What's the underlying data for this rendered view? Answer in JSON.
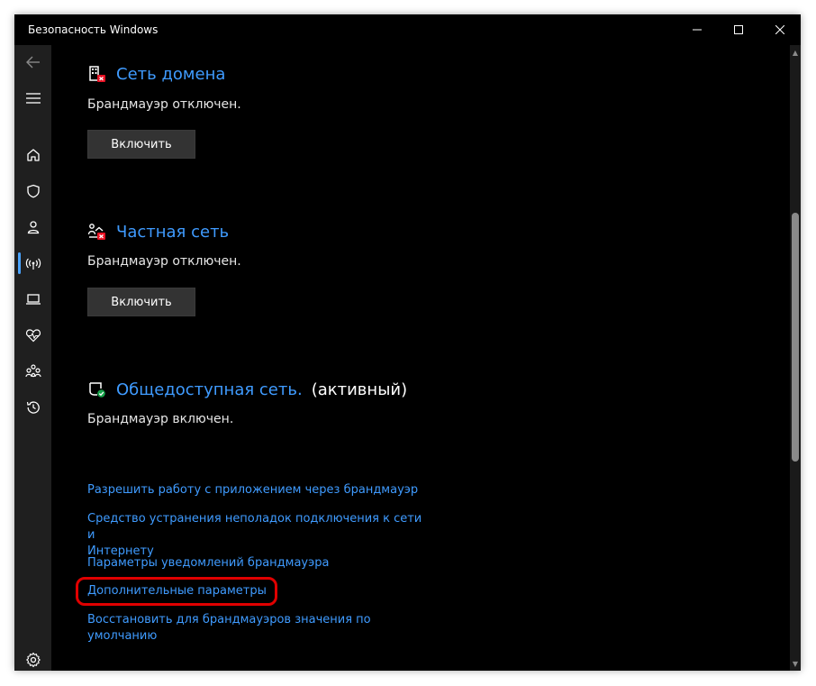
{
  "window": {
    "title": "Безопасность Windows"
  },
  "sections": [
    {
      "title": "Сеть домена",
      "suffix": "",
      "status": "Брандмауэр отключен.",
      "button_label": "Включить",
      "icon": "domain-network-icon"
    },
    {
      "title": "Частная сеть",
      "suffix": "",
      "status": "Брандмауэр отключен.",
      "button_label": "Включить",
      "icon": "private-network-icon"
    },
    {
      "title": "Общедоступная сеть.",
      "suffix": "(активный)",
      "status": "Брандмауэр включен.",
      "icon": "public-network-icon"
    }
  ],
  "links": {
    "allow_app": "Разрешить работу с приложением через брандмауэр",
    "troubleshooter_line1": "Средство устранения неполадок подключения к сети и",
    "troubleshooter_line2": "Интернету",
    "notifications": "Параметры уведомлений брандмауэра",
    "advanced": "Дополнительные параметры",
    "restore_defaults": "Восстановить для брандмауэров значения по умолчанию"
  },
  "sidebar": {
    "items": [
      "back-arrow-icon",
      "hamburger-menu-icon",
      "home-icon",
      "shield-icon",
      "account-icon",
      "network-antenna-icon",
      "device-laptop-icon",
      "health-heart-icon",
      "family-icon",
      "history-icon",
      "settings-gear-icon"
    ],
    "active_item": "network-antenna-icon"
  },
  "colors": {
    "link": "#3f9bff",
    "background": "#000000",
    "sidebar": "#1f1f1f",
    "button": "#333333",
    "highlight": "#e00000",
    "active_indicator": "#4aa3ff"
  }
}
